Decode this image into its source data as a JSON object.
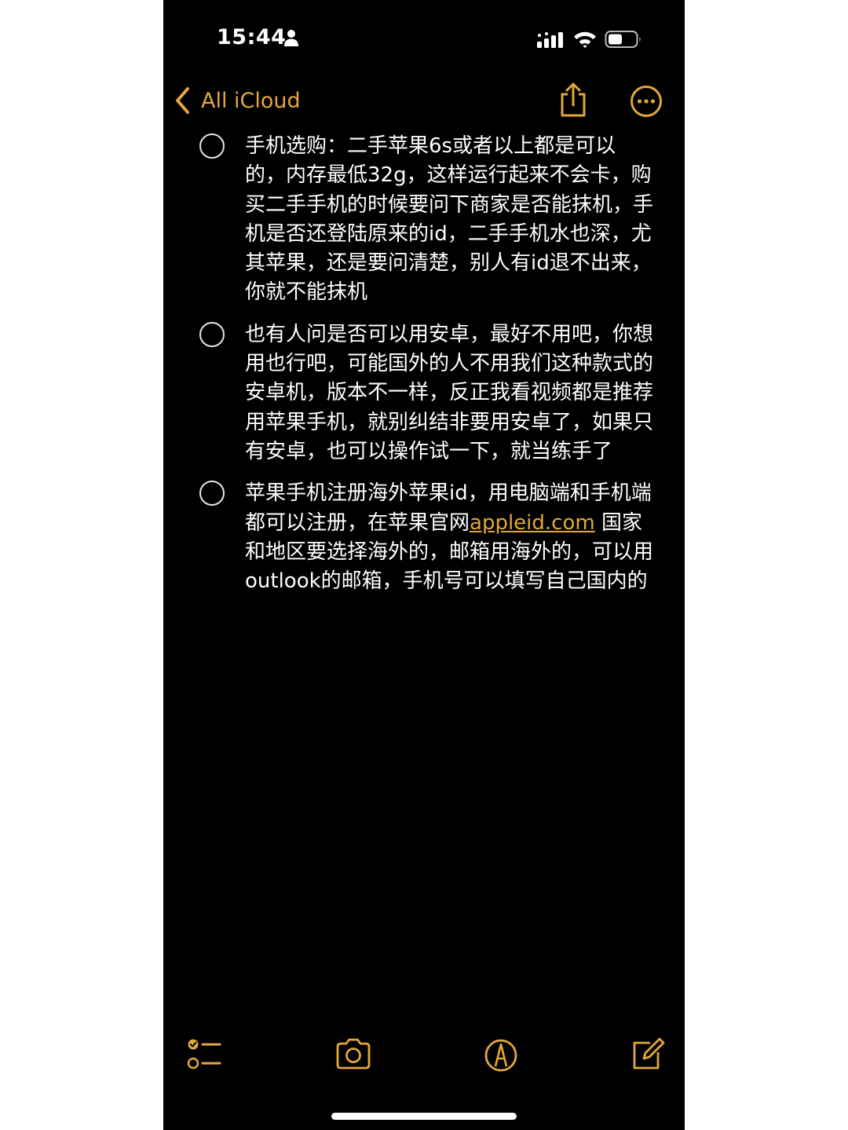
{
  "status_bar": {
    "time": "15:44",
    "icons": [
      "person-icon",
      "signal-icon",
      "wifi-icon",
      "battery-icon"
    ]
  },
  "nav": {
    "back_label": "All iCloud",
    "icons": [
      "chevron-left-icon",
      "share-icon",
      "more-icon"
    ]
  },
  "colors": {
    "accent": "#e2a83a",
    "background": "#000000",
    "text": "#ffffff"
  },
  "checklist": [
    {
      "checked": false,
      "text": "手机选购：二手苹果6s或者以上都是可以的，内存最低32g，这样运行起来不会卡，购买二手手机的时候要问下商家是否能抹机，手机是否还登陆原来的id，二手手机水也深，尤其苹果，还是要问清楚，别人有id退不出来，你就不能抹机"
    },
    {
      "checked": false,
      "text": "也有人问是否可以用安卓，最好不用吧，你想用也行吧，可能国外的人不用我们这种款式的安卓机，版本不一样，反正我看视频都是推荐用苹果手机，就别纠结非要用安卓了，如果只有安卓，也可以操作试一下，就当练手了"
    },
    {
      "checked": false,
      "text_before": "苹果手机注册海外苹果id，用电脑端和手机端都可以注册，在苹果官网",
      "link": "appleid.com",
      "text_after": " 国家和地区要选择海外的，邮箱用海外的，可以用outlook的邮箱，手机号可以填写自己国内的"
    }
  ],
  "toolbar": {
    "icons": [
      "checklist-icon",
      "camera-icon",
      "markup-icon",
      "compose-icon"
    ]
  }
}
